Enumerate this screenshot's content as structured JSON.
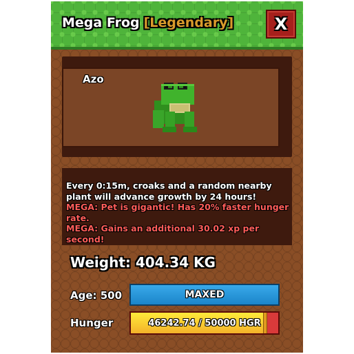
{
  "header": {
    "pet_title": "Mega Frog",
    "rarity": "[Legendary]",
    "close_label": "X",
    "close_icon": "close-icon"
  },
  "pet": {
    "name": "Azo",
    "image": "frog-icon"
  },
  "description": {
    "line1": "Every 0:15m, croaks and a random nearby plant will advance growth by 24 hours!",
    "mega1": "MEGA: Pet is gigantic! Has 20% faster hunger rate.",
    "mega2": "MEGA: Gains an additional 30.02 xp per second!"
  },
  "stats": {
    "weight": "Weight: 404.34 KG",
    "age_label": "Age: 500",
    "age_bar_text": "MAXED",
    "hunger_label": "Hunger",
    "hunger_text": "46242.74 / 50000 HGR",
    "hunger_fraction": 0.9249
  },
  "colors": {
    "header_green": "#4fb43b",
    "panel_brown": "#8a4e26",
    "rarity_gold": "#d99a2b",
    "mega_red": "#ff5d59",
    "age_blue": "#1b85c9",
    "hunger_yellow": "#f4b22a"
  }
}
